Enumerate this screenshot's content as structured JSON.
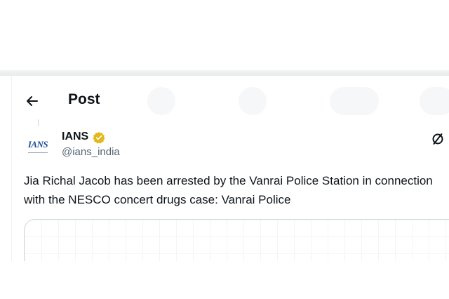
{
  "header": {
    "back_icon": "arrow-left-icon",
    "title": "Post"
  },
  "post": {
    "author": {
      "name": "IANS",
      "handle": "@ians_india",
      "avatar_text": "IANS",
      "verified_badge_color": "#e2b719"
    },
    "more_icon": "slash-circle-icon",
    "text": "Jia Richal Jacob has been arrested by  the Vanrai Police Station in connection with the NESCO concert drugs case: Vanrai Police"
  },
  "colors": {
    "text_primary": "#0f1419",
    "text_secondary": "#536471",
    "border": "#cfd9de",
    "avatar_brand": "#1d4e9e"
  }
}
